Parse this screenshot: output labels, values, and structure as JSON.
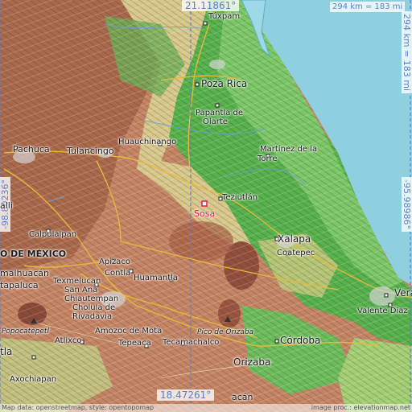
{
  "map": {
    "colors": {
      "sea": "#8ecfe0",
      "lowland": "#4fb84a",
      "mid": "#c9d38a",
      "highland": "#b77a5a",
      "road": "#e8b838",
      "marker": "#e0194f"
    },
    "coords": {
      "top_lat": "21.11861°",
      "bottom_lat": "18.47261°",
      "left_lon": "-98.80236°",
      "right_lon": "-95.98986°",
      "scale_h": "294 km = 183 mi",
      "scale_v": "294 km = 183 mi"
    },
    "highlight": {
      "name": "Sosa"
    },
    "places": {
      "tuxpam": "Túxpam",
      "poza_rica": "Poza Rica",
      "papantla_1": "Papantla de",
      "papantla_2": "Olarte",
      "pachuca": "Pachuca",
      "tulancingo": "Tulancingo",
      "huauchinango": "Huauchinango",
      "martinez_1": "Martínez de la",
      "martinez_2": "Torre",
      "teziutlan": "Teziutlán",
      "xalapa": "Xalapa",
      "coatepec": "Coatepec",
      "calpulalpan": "Calpulalpan",
      "mexico": "O DE MÉXICO",
      "apizaco": "Apizaco",
      "contla": "Contla",
      "huamantla": "Huamantla",
      "malhuacan": "malhuacán",
      "texmelucan": "Texmelucan",
      "san_ana": "San Ana",
      "chiautempan": "Chiautempan",
      "cholula_1": "Cholula de",
      "cholula_2": "Rivadavia",
      "tapaluca": "tapaluca",
      "popocatepetl": "Popocatépetl",
      "amozoc": "Amozoc de Mota",
      "atlixco": "Atlixco",
      "tepeaca": "Tepeaca",
      "tecamachalco": "Tecamachalco",
      "pico_orizaba": "Pico de Orizaba",
      "cordoba": "Córdoba",
      "orizaba": "Orizaba",
      "veracruz": "Vera",
      "valente": "Valente Díaz",
      "tla": "tla",
      "axochiapan": "Axochiapan",
      "alli": "alli",
      "acan": "acán"
    },
    "attribution_left": "Map data: openstreetmap, style: opentopomap",
    "attribution_right": "image proc.: elevationmap.net"
  }
}
